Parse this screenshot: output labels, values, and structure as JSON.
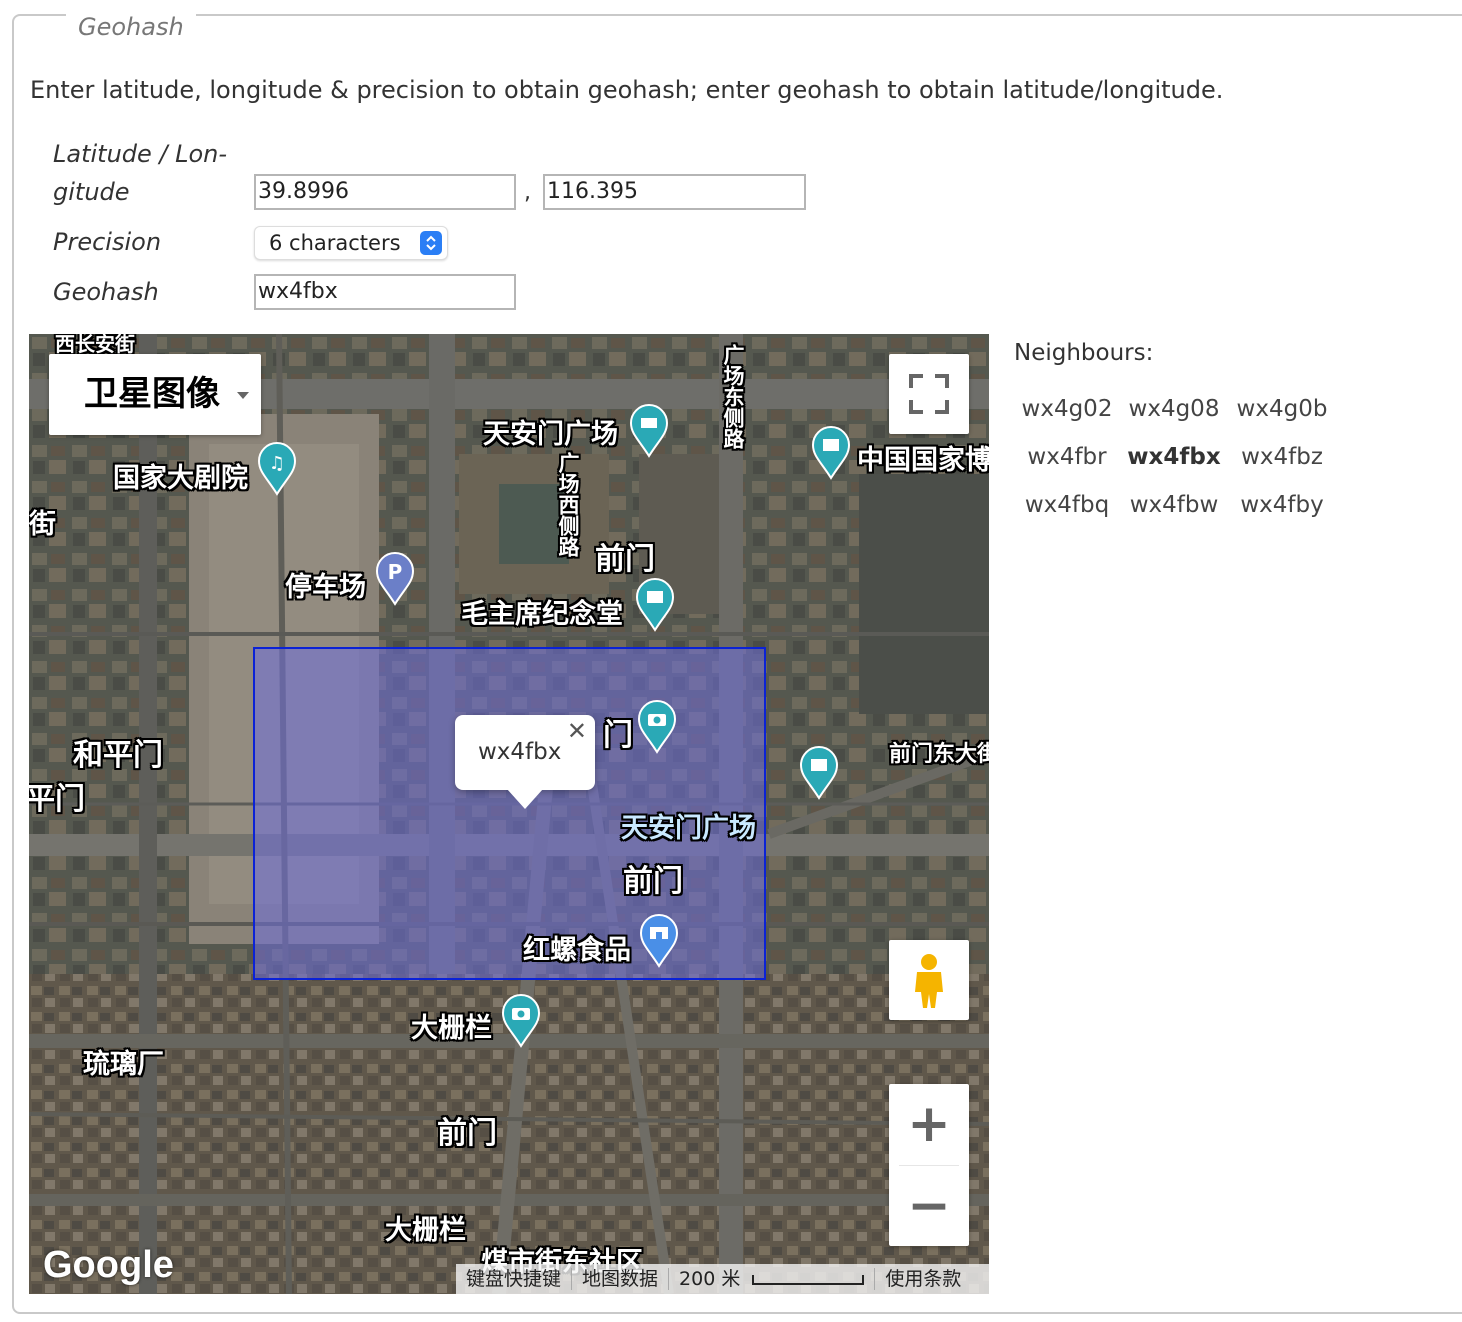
{
  "fieldset": {
    "legend": "Geohash"
  },
  "intro": "Enter latitude, longitude & precision to obtain geohash; enter geohash to obtain latitude/longitude.",
  "form": {
    "latlon_label_line1": "Latitude / Lon-",
    "latlon_label_line2": "gitude",
    "latitude": "39.8996",
    "separator": ",",
    "longitude": "116.395",
    "precision_label": "Precision",
    "precision_value": "6 characters",
    "geohash_label": "Geohash",
    "geohash": "wx4fbx"
  },
  "map": {
    "map_type": "卫星图像",
    "infowindow_text": "wx4fbx",
    "infowindow_close": "✕",
    "zoom_in": "+",
    "zoom_out": "−",
    "google_logo": "Google",
    "footer": {
      "keyboard": "键盘快捷键",
      "map_data": "地图数据",
      "scale": "200 米",
      "terms": "使用条款"
    },
    "labels": {
      "xichangan": "西长安街",
      "tiananmen_square": "天安门广场",
      "guangchang_east": "广场东侧路",
      "guangchang_west": "广场西侧路",
      "national_museum": "中国国家博",
      "national_theater": "国家大剧院",
      "jie": "街",
      "qianmen_top": "前门",
      "parking": "停车场",
      "mao_memorial": "毛主席纪念堂",
      "men_partial": "门",
      "heping": "和平门",
      "ping_men": "平门",
      "qianmen_east": "前门东大街",
      "tiananmen_square2": "天安门广场",
      "qianmen_mid": "前门",
      "hongluo": "红螺食品",
      "dashilan_top": "大栅栏",
      "liulichang": "琉璃厂",
      "qianmen_bottom": "前门",
      "dashilan_bottom": "大栅栏",
      "meishijie": "煤市街东社区"
    },
    "colors": {
      "geohash_box_fill": "#7070dc",
      "geohash_box_border": "#0b22d6",
      "pin_teal": "#2aa9b6",
      "pin_blue": "#4a8fe7",
      "pin_parking": "#6b7fc8"
    }
  },
  "neighbours": {
    "title": "Neighbours:",
    "grid": [
      [
        "wx4g02",
        "wx4g08",
        "wx4g0b"
      ],
      [
        "wx4fbr",
        "wx4fbx",
        "wx4fbz"
      ],
      [
        "wx4fbq",
        "wx4fbw",
        "wx4fby"
      ]
    ]
  }
}
